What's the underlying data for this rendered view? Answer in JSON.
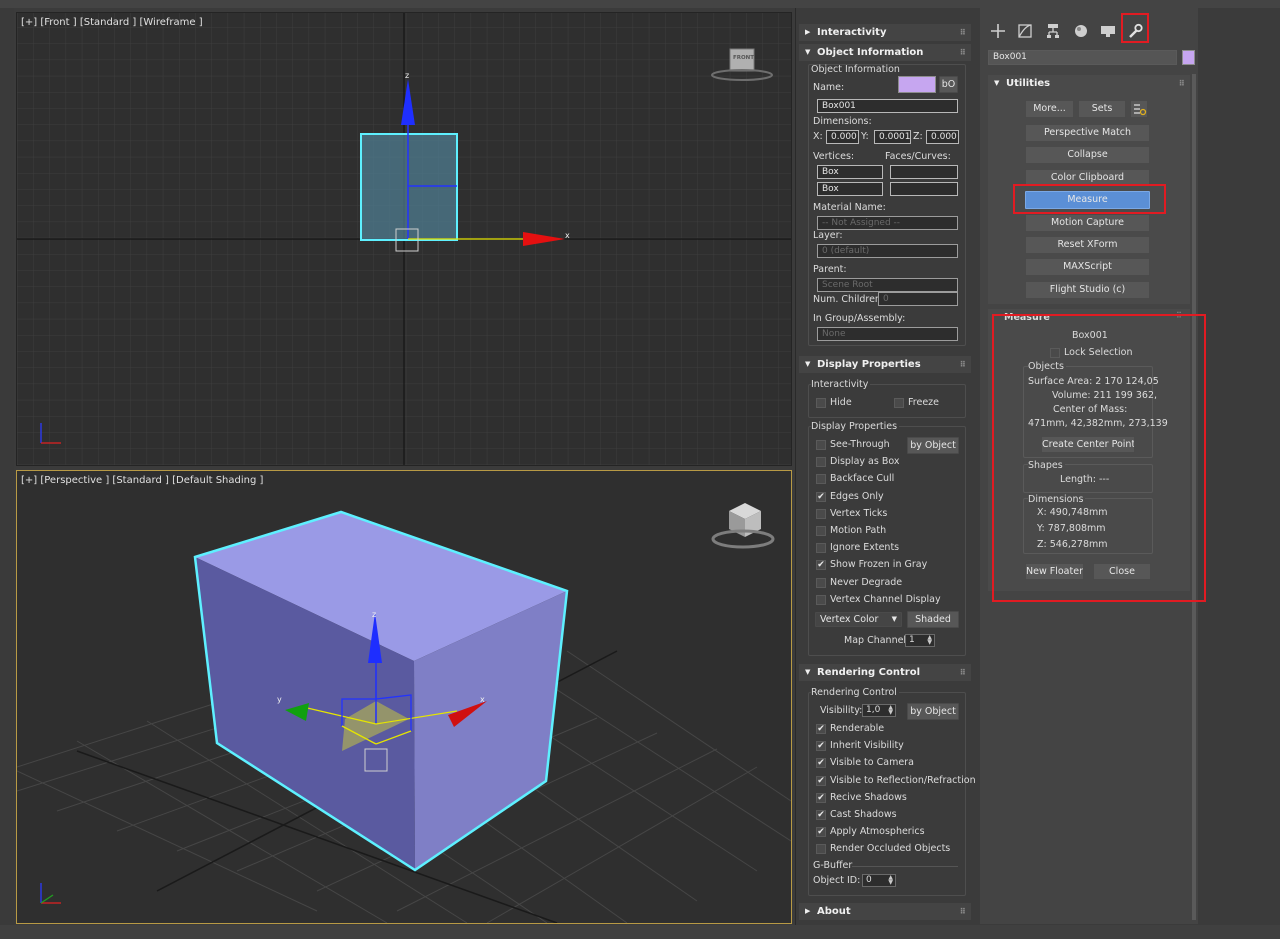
{
  "viewports": {
    "front_label": "[+] [Front ] [Standard ] [Wireframe ]",
    "front_cube_label": "FRONT",
    "persp_label": "[+] [Perspective ] [Standard ] [Default Shading ]",
    "axis_x": "x",
    "axis_y": "y",
    "axis_z": "z"
  },
  "panel": {
    "interactivity_rollout": "Interactivity",
    "object_info_rollout": "Object Information",
    "object_info_group": "Object Information",
    "name_label": "Name:",
    "name_btn": "bO",
    "name_value": "Box001",
    "dimensions_label": "Dimensions:",
    "dim_x_label": "X:",
    "dim_x": "0.000",
    "dim_y_label": "Y:",
    "dim_y": "0.0001",
    "dim_z_label": "Z:",
    "dim_z": "0.000",
    "vertices_label": "Vertices:",
    "faces_label": "Faces/Curves:",
    "vert_val1": "Box",
    "vert_val2": "Box",
    "material_label": "Material Name:",
    "material_value": "-- Not Assigned --",
    "layer_label": "Layer:",
    "layer_value": "0 (default)",
    "parent_label": "Parent:",
    "parent_value": "Scene Root",
    "num_children_label": "Num. Children:",
    "num_children_value": "0",
    "group_label": "In Group/Assembly:",
    "group_value": "None",
    "display_rollout": "Display Properties",
    "interactivity_group": "Interactivity",
    "hide": "Hide",
    "freeze": "Freeze",
    "display_group": "Display Properties",
    "by_object": "by Object",
    "display_checks": [
      {
        "label": "See-Through",
        "checked": false
      },
      {
        "label": "Display as Box",
        "checked": false
      },
      {
        "label": "Backface Cull",
        "checked": false
      },
      {
        "label": "Edges Only",
        "checked": true
      },
      {
        "label": "Vertex Ticks",
        "checked": false
      },
      {
        "label": "Motion Path",
        "checked": false
      },
      {
        "label": "Ignore Extents",
        "checked": false
      },
      {
        "label": "Show Frozen in Gray",
        "checked": true
      },
      {
        "label": "Never Degrade",
        "checked": false
      },
      {
        "label": "Vertex Channel Display",
        "checked": false
      }
    ],
    "vertex_color": "Vertex Color",
    "shaded": "Shaded",
    "map_channel_label": "Map Channel:",
    "map_channel_value": "1",
    "render_rollout": "Rendering Control",
    "render_group": "Rendering Control",
    "visibility_label": "Visibility:",
    "visibility_value": "1,0",
    "render_by_object": "by Object",
    "render_checks": [
      {
        "label": "Renderable",
        "checked": true
      },
      {
        "label": "Inherit Visibility",
        "checked": true
      },
      {
        "label": "Visible to Camera",
        "checked": true
      },
      {
        "label": "Visible to Reflection/Refraction",
        "checked": true
      },
      {
        "label": "Recive Shadows",
        "checked": true
      },
      {
        "label": "Cast Shadows",
        "checked": true
      },
      {
        "label": "Apply Atmospherics",
        "checked": true
      },
      {
        "label": "Render Occluded Objects",
        "checked": false
      }
    ],
    "gbuffer_label": "G-Buffer",
    "object_id_label": "Object ID:",
    "object_id_value": "0",
    "about_rollout": "About"
  },
  "cmd": {
    "tab_icons": [
      "create-icon",
      "modify-icon",
      "hierarchy-icon",
      "motion-icon",
      "display-icon",
      "utilities-icon"
    ],
    "object_name": "Box001",
    "object_color": "#c6a6f0",
    "utilities_rollout": "Utilities",
    "more": "More...",
    "sets": "Sets",
    "buttons": [
      "Perspective Match",
      "Collapse",
      "Color Clipboard",
      "Measure",
      "Motion Capture",
      "Reset XForm",
      "MAXScript",
      "Flight Studio (c)"
    ],
    "measure_rollout": "Measure",
    "measure_object": "Box001",
    "lock_selection": "Lock Selection",
    "objects_group": "Objects",
    "surface_area": "Surface Area:  2 170 124,05",
    "volume": "Volume:  211 199 362,",
    "center_mass_label": "Center of Mass:",
    "center_mass_value": "471mm, 42,382mm, 273,139",
    "create_center_point": "Create Center Point",
    "shapes_group": "Shapes",
    "length": "Length:  ---",
    "dimensions_group": "Dimensions",
    "dim_x": "X:   490,748mm",
    "dim_y": "Y:   787,808mm",
    "dim_z": "Z:   546,278mm",
    "new_floater": "New Floater",
    "close": "Close"
  },
  "colors": {
    "selection_cyan": "#5ef0ff",
    "box_fill": "#9a9ae6",
    "highlight_red": "#e11b22",
    "active_button": "#5b8fd6",
    "viewport_bg": "#2f2f2f"
  }
}
